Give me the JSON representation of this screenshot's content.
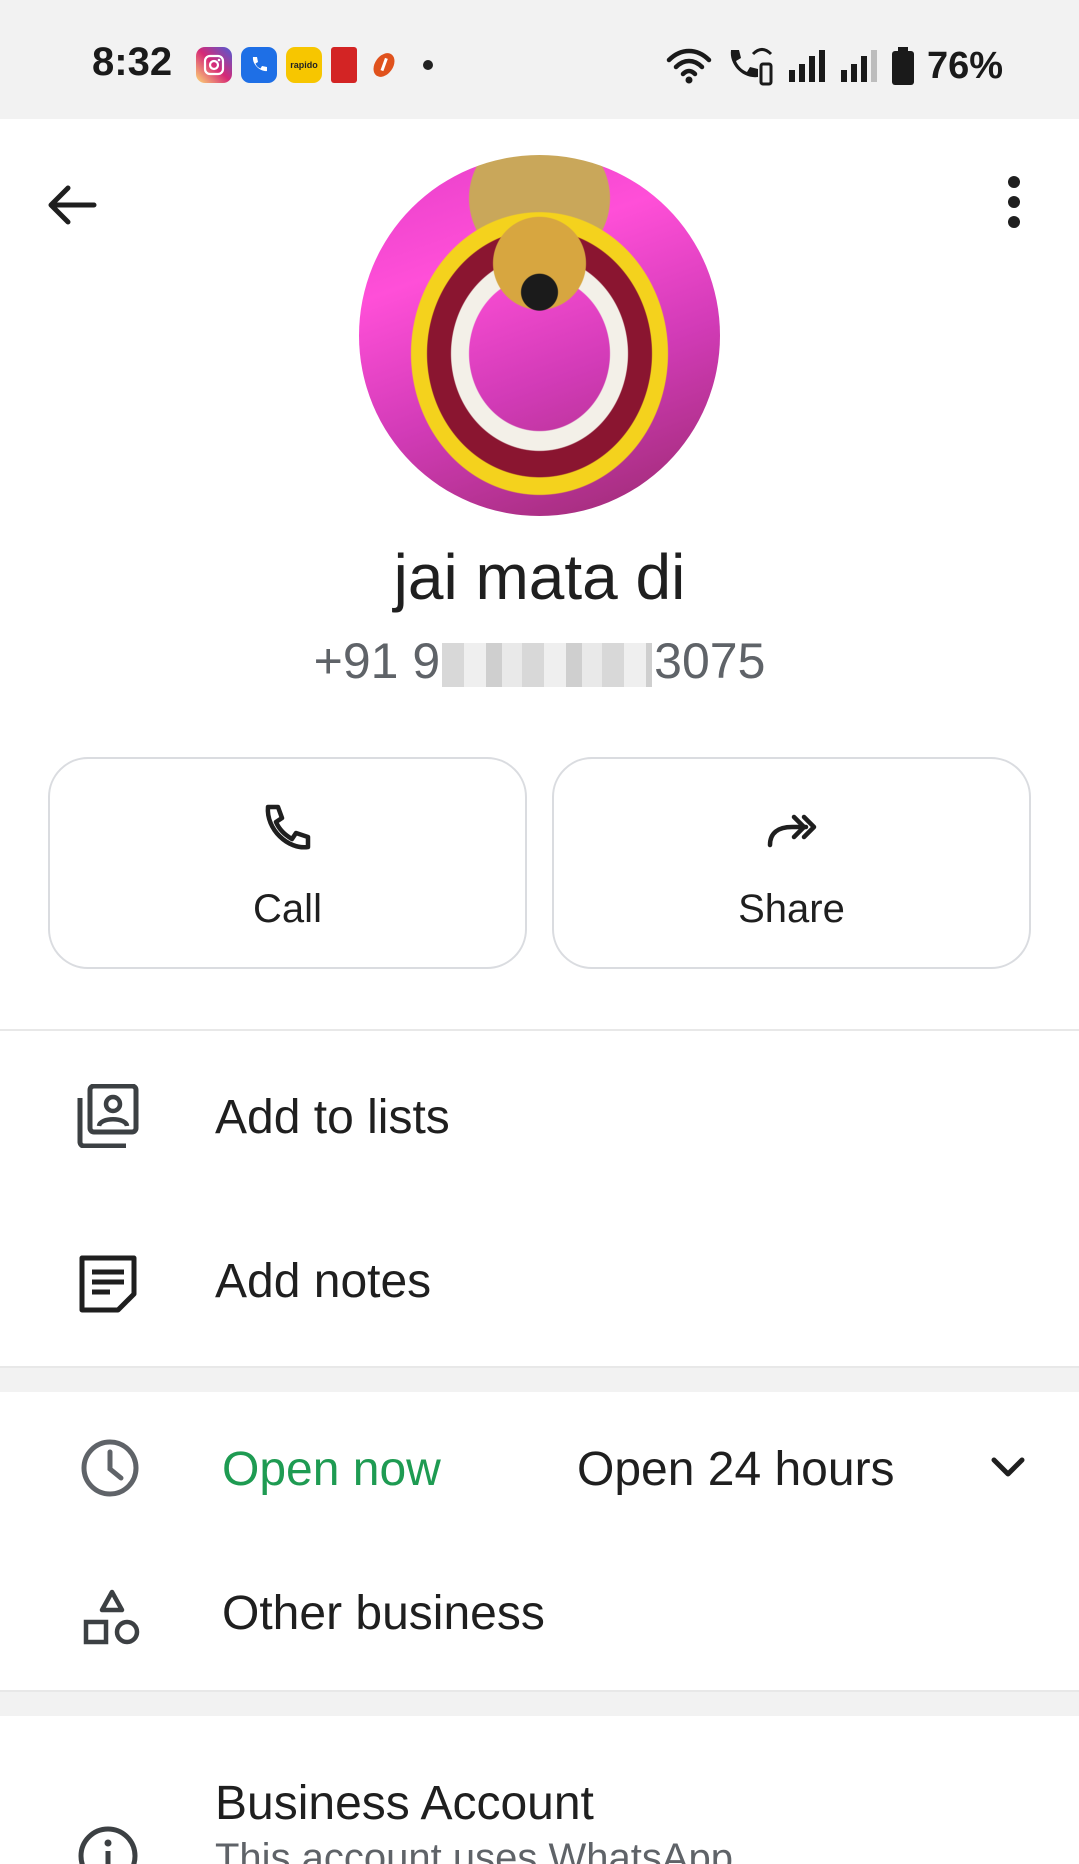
{
  "status_bar": {
    "time": "8:32",
    "battery": "76%",
    "app_icons": [
      "instagram-icon",
      "truecaller-icon",
      "rapido-icon",
      "red-app-icon",
      "icici-icon"
    ],
    "rapido_label": "rapido"
  },
  "contact": {
    "name": "jai mata di",
    "phone_prefix": "+91 9",
    "phone_suffix": "3075"
  },
  "actions": {
    "call_label": "Call",
    "share_label": "Share"
  },
  "list": {
    "add_to_lists": "Add to lists",
    "add_notes": "Add notes"
  },
  "business": {
    "open_status": "Open now",
    "hours": "Open 24 hours",
    "category": "Other business",
    "account_title": "Business Account",
    "account_subtitle": "This account uses WhatsApp"
  },
  "colors": {
    "open_green": "#1e9b52",
    "status_bar_bg": "#f2f2f2",
    "text_primary": "#1f1f1f",
    "text_secondary": "#5f6368"
  }
}
